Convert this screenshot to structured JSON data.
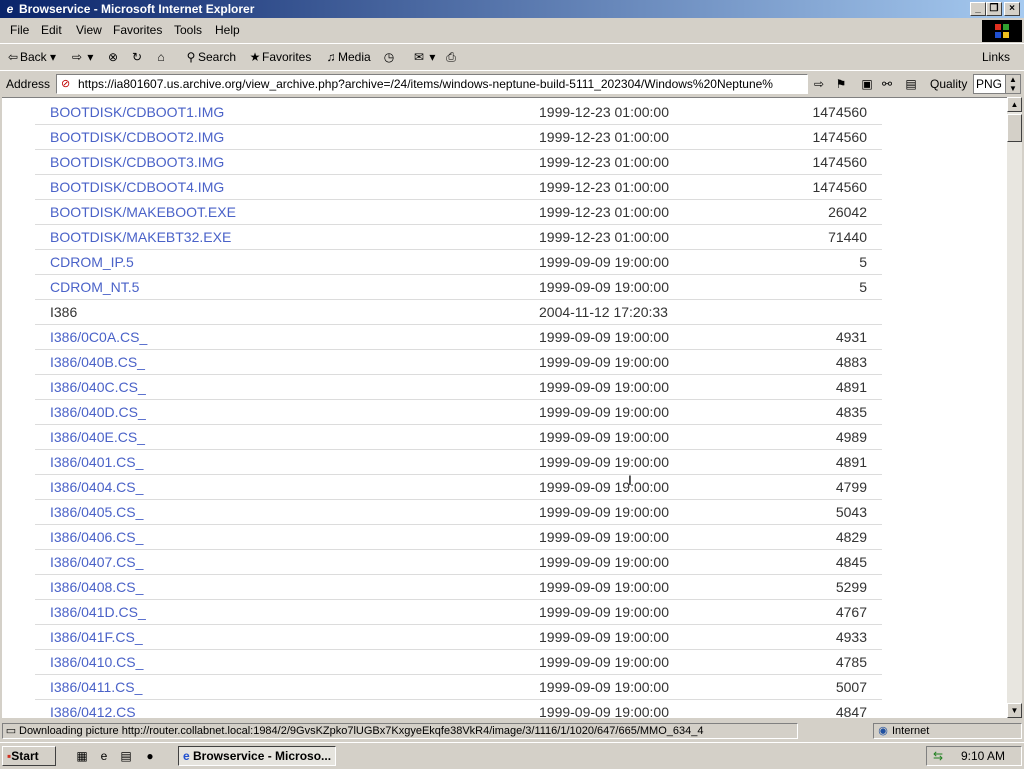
{
  "window": {
    "title": "Browservice - Microsoft Internet Explorer",
    "btn_min": "_",
    "btn_max": "❐",
    "btn_close": "×"
  },
  "menu": [
    "File",
    "Edit",
    "View",
    "Favorites",
    "Tools",
    "Help"
  ],
  "toolbar": {
    "back": "Back",
    "search": "Search",
    "favorites": "Favorites",
    "media": "Media",
    "links": "Links"
  },
  "address": {
    "label": "Address",
    "url": "https://ia801607.us.archive.org/view_archive.php?archive=/24/items/windows-neptune-build-5111_202304/Windows%20Neptune%",
    "quality_label": "Quality",
    "quality_value": "PNG"
  },
  "rows": [
    {
      "name": "BOOTDISK/CDBOOT1.IMG",
      "date": "1999-12-23 01:00:00",
      "size": "1474560",
      "link": true
    },
    {
      "name": "BOOTDISK/CDBOOT2.IMG",
      "date": "1999-12-23 01:00:00",
      "size": "1474560",
      "link": true
    },
    {
      "name": "BOOTDISK/CDBOOT3.IMG",
      "date": "1999-12-23 01:00:00",
      "size": "1474560",
      "link": true
    },
    {
      "name": "BOOTDISK/CDBOOT4.IMG",
      "date": "1999-12-23 01:00:00",
      "size": "1474560",
      "link": true
    },
    {
      "name": "BOOTDISK/MAKEBOOT.EXE",
      "date": "1999-12-23 01:00:00",
      "size": "26042",
      "link": true
    },
    {
      "name": "BOOTDISK/MAKEBT32.EXE",
      "date": "1999-12-23 01:00:00",
      "size": "71440",
      "link": true
    },
    {
      "name": "CDROM_IP.5",
      "date": "1999-09-09 19:00:00",
      "size": "5",
      "link": true
    },
    {
      "name": "CDROM_NT.5",
      "date": "1999-09-09 19:00:00",
      "size": "5",
      "link": true
    },
    {
      "name": "I386",
      "date": "2004-11-12 17:20:33",
      "size": "",
      "link": false
    },
    {
      "name": "I386/0C0A.CS_",
      "date": "1999-09-09 19:00:00",
      "size": "4931",
      "link": true
    },
    {
      "name": "I386/040B.CS_",
      "date": "1999-09-09 19:00:00",
      "size": "4883",
      "link": true
    },
    {
      "name": "I386/040C.CS_",
      "date": "1999-09-09 19:00:00",
      "size": "4891",
      "link": true
    },
    {
      "name": "I386/040D.CS_",
      "date": "1999-09-09 19:00:00",
      "size": "4835",
      "link": true
    },
    {
      "name": "I386/040E.CS_",
      "date": "1999-09-09 19:00:00",
      "size": "4989",
      "link": true
    },
    {
      "name": "I386/0401.CS_",
      "date": "1999-09-09 19:00:00",
      "size": "4891",
      "link": true
    },
    {
      "name": "I386/0404.CS_",
      "date": "1999-09-09 19:00:00",
      "size": "4799",
      "link": true
    },
    {
      "name": "I386/0405.CS_",
      "date": "1999-09-09 19:00:00",
      "size": "5043",
      "link": true
    },
    {
      "name": "I386/0406.CS_",
      "date": "1999-09-09 19:00:00",
      "size": "4829",
      "link": true
    },
    {
      "name": "I386/0407.CS_",
      "date": "1999-09-09 19:00:00",
      "size": "4845",
      "link": true
    },
    {
      "name": "I386/0408.CS_",
      "date": "1999-09-09 19:00:00",
      "size": "5299",
      "link": true
    },
    {
      "name": "I386/041D.CS_",
      "date": "1999-09-09 19:00:00",
      "size": "4767",
      "link": true
    },
    {
      "name": "I386/041F.CS_",
      "date": "1999-09-09 19:00:00",
      "size": "4933",
      "link": true
    },
    {
      "name": "I386/0410.CS_",
      "date": "1999-09-09 19:00:00",
      "size": "4785",
      "link": true
    },
    {
      "name": "I386/0411.CS_",
      "date": "1999-09-09 19:00:00",
      "size": "5007",
      "link": true
    },
    {
      "name": "I386/0412.CS",
      "date": "1999-09-09 19:00:00",
      "size": "4847",
      "link": true
    }
  ],
  "status": {
    "text": "Downloading picture http://router.collabnet.local:1984/2/9GvsKZpko7lUGBx7KxgyeEkqfe38VkR4/image/3/1116/1/1020/647/665/MMO_634_4",
    "zone": "Internet"
  },
  "taskbar": {
    "start": "Start",
    "task": "Browservice - Microso...",
    "clock": "9:10 AM"
  },
  "colors": {
    "link": "#4a62c8",
    "title_start": "#0a246a",
    "title_end": "#a6caf0",
    "chrome": "#d4d0c8"
  }
}
